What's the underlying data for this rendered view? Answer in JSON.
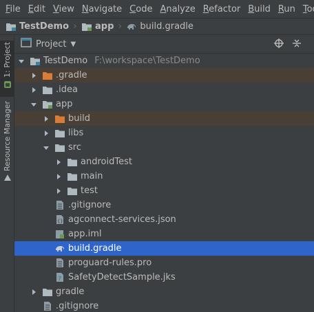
{
  "menu": [
    "File",
    "Edit",
    "View",
    "Navigate",
    "Code",
    "Analyze",
    "Refactor",
    "Build",
    "Run",
    "Tools"
  ],
  "breadcrumb": [
    {
      "label": "TestDemo",
      "icon": "module-folder-icon"
    },
    {
      "label": "app",
      "icon": "module-folder-icon"
    },
    {
      "label": "build.gradle",
      "icon": "gradle-elephant-icon"
    }
  ],
  "sidebar": {
    "project_tab": "1: Project",
    "resource_tab": "Resource Manager"
  },
  "panel": {
    "title": "Project"
  },
  "tree": {
    "root_label": "TestDemo",
    "root_path": "F:\\workspace\\TestDemo",
    "gradle_dir": ".gradle",
    "idea_dir": ".idea",
    "app_dir": "app",
    "build_dir": "build",
    "libs_dir": "libs",
    "src_dir": "src",
    "android_test_dir": "androidTest",
    "main_dir": "main",
    "test_dir": "test",
    "app_gitignore": ".gitignore",
    "agconnect_file": "agconnect-services.json",
    "app_iml": "app.iml",
    "build_gradle": "build.gradle",
    "proguard_file": "proguard-rules.pro",
    "jks_file": "SafetyDetectSample.jks",
    "gradle_root_dir": "gradle",
    "root_gitignore": ".gitignore"
  },
  "colors": {
    "background": "#3c3f41",
    "selection": "#2f65ca",
    "excluded_row": "#4a3f35",
    "excluded_folder": "#d87c3a",
    "folder": "#aeb9c0"
  }
}
